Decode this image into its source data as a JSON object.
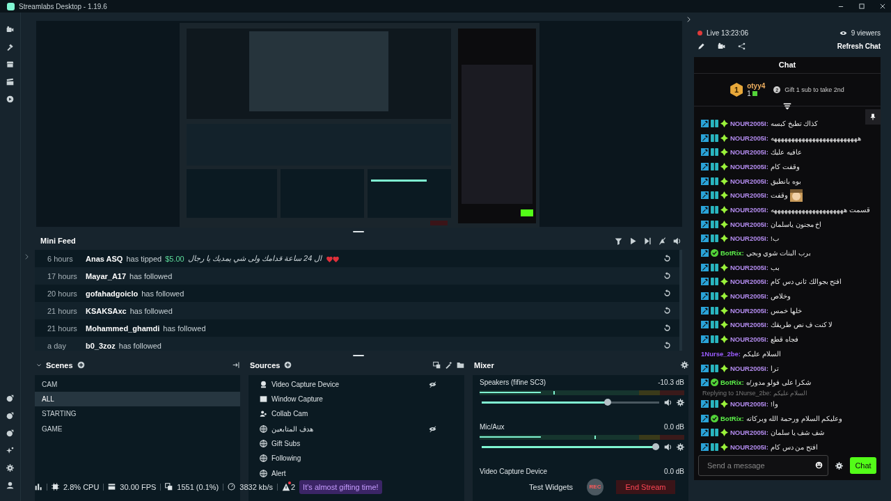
{
  "window": {
    "title": "Streamlabs Desktop - 1.19.6"
  },
  "nav": {
    "top": [
      {
        "kind": "camera"
      },
      {
        "kind": "themes"
      },
      {
        "kind": "store"
      },
      {
        "kind": "clapper"
      },
      {
        "kind": "play"
      }
    ],
    "bottom": [
      {
        "kind": "link1"
      },
      {
        "kind": "link2"
      },
      {
        "kind": "link3"
      },
      {
        "kind": "sparkle"
      },
      {
        "kind": "settings"
      },
      {
        "kind": "user"
      }
    ]
  },
  "mini_feed": {
    "title": "Mini Feed",
    "rows": [
      {
        "time": "6 hours",
        "user": "Anas ASQ",
        "action": "has tipped",
        "amount": "$5.00",
        "message": "ال 24 ساعة قدامك ولى شي يمديك يا رجال",
        "hearts": true
      },
      {
        "time": "17 hours",
        "user": "Mayar_A17",
        "action": "has followed"
      },
      {
        "time": "20 hours",
        "user": "gofahadgoiclo",
        "action": "has followed"
      },
      {
        "time": "21 hours",
        "user": "KSAKSAxc",
        "action": "has followed"
      },
      {
        "time": "21 hours",
        "user": "Mohammed_ghamdi",
        "action": "has followed"
      },
      {
        "time": "a day",
        "user": "b0_3zoz",
        "action": "has followed"
      }
    ]
  },
  "scenes": {
    "title": "Scenes",
    "items": [
      {
        "name": "CAM",
        "selected": false
      },
      {
        "name": "ALL",
        "selected": true
      },
      {
        "name": "STARTING",
        "selected": false
      },
      {
        "name": "GAME",
        "selected": false
      }
    ]
  },
  "sources": {
    "title": "Sources",
    "items": [
      {
        "name": "Video Capture Device",
        "kind": "webcam",
        "hidden": true
      },
      {
        "name": "Window Capture",
        "kind": "window",
        "hidden": false
      },
      {
        "name": "Collab Cam",
        "kind": "collab",
        "hidden": false
      },
      {
        "name": "هدف المتابعين",
        "kind": "browser",
        "hidden": true
      },
      {
        "name": "Gift Subs",
        "kind": "browser",
        "hidden": false
      },
      {
        "name": "Following",
        "kind": "browser",
        "hidden": false
      },
      {
        "name": "Alert",
        "kind": "browser",
        "hidden": false
      }
    ]
  },
  "mixer": {
    "title": "Mixer",
    "channels": [
      {
        "name": "Speakers (fifine SC3)",
        "reading": "-10.3 dB",
        "level": 0.72
      },
      {
        "name": "Mic/Aux",
        "reading": "0.0 dB",
        "level": 1.0
      },
      {
        "name": "Video Capture Device",
        "reading": "0.0 dB"
      }
    ]
  },
  "status_bar": {
    "cpu": "2.8% CPU",
    "fps": "30.00 FPS",
    "dropped": "1551 (0.1%)",
    "bitrate": "3832 kb/s",
    "alerts": "2",
    "notice": "It's almost gifting time!",
    "test_widgets": "Test Widgets",
    "rec": "REC",
    "end_stream": "End Stream"
  },
  "stream_info": {
    "live": "Live 13:23:06",
    "viewers": "9 viewers",
    "refresh": "Refresh Chat"
  },
  "chat": {
    "title": "Chat",
    "leader": {
      "rank": "1",
      "name": "otyy4",
      "count": "1",
      "next_rank": "2",
      "goal": "Gift 1 sub to take 2nd"
    },
    "messages": [
      {
        "badges": [
          {
            "kind": "mod"
          },
          {
            "kind": "bg"
          },
          {
            "kind": "gem"
          }
        ],
        "user": "NOUR2005I:",
        "color": "#b48cf0",
        "text": "كذاك تطبخ كبسه"
      },
      {
        "badges": [
          {
            "kind": "mod"
          },
          {
            "kind": "bg"
          },
          {
            "kind": "gem"
          }
        ],
        "user": "NOUR2005I:",
        "color": "#b48cf0",
        "text": "هههههههههههههههههههههههههه"
      },
      {
        "badges": [
          {
            "kind": "mod"
          },
          {
            "kind": "bg"
          },
          {
            "kind": "gem"
          }
        ],
        "user": "NOUR2005I:",
        "color": "#b48cf0",
        "text": "عافيه عليك"
      },
      {
        "badges": [
          {
            "kind": "mod"
          },
          {
            "kind": "bg"
          },
          {
            "kind": "gem"
          }
        ],
        "user": "NOUR2005I:",
        "color": "#b48cf0",
        "text": "وقفت كام"
      },
      {
        "badges": [
          {
            "kind": "mod"
          },
          {
            "kind": "bg"
          },
          {
            "kind": "gem"
          }
        ],
        "user": "NOUR2005I:",
        "color": "#b48cf0",
        "text": "بوه بانطيق"
      },
      {
        "badges": [
          {
            "kind": "mod"
          },
          {
            "kind": "bg"
          },
          {
            "kind": "gem"
          }
        ],
        "user": "NOUR2005I:",
        "color": "#b48cf0",
        "text": "وقفت",
        "emote": true
      },
      {
        "badges": [
          {
            "kind": "mod"
          },
          {
            "kind": "bg"
          },
          {
            "kind": "gem"
          }
        ],
        "user": "NOUR2005I:",
        "color": "#b48cf0",
        "text": "قسمت هههههههههههههههههههههه"
      },
      {
        "badges": [
          {
            "kind": "mod"
          },
          {
            "kind": "bg"
          },
          {
            "kind": "gem"
          }
        ],
        "user": "NOUR2005I:",
        "color": "#b48cf0",
        "text": "اخ مجنون ياسلمان"
      },
      {
        "badges": [
          {
            "kind": "mod"
          },
          {
            "kind": "bg"
          },
          {
            "kind": "gem"
          }
        ],
        "user": "NOUR2005I:",
        "color": "#b48cf0",
        "text": "ب!"
      },
      {
        "badges": [
          {
            "kind": "mod"
          },
          {
            "kind": "verified"
          }
        ],
        "user": "BotRix:",
        "color": "#5df34a",
        "text": "برب البنات شوي وبجي"
      },
      {
        "badges": [
          {
            "kind": "mod"
          },
          {
            "kind": "bg"
          },
          {
            "kind": "gem"
          }
        ],
        "user": "NOUR2005I:",
        "color": "#b48cf0",
        "text": "بب"
      },
      {
        "badges": [
          {
            "kind": "mod"
          },
          {
            "kind": "bg"
          },
          {
            "kind": "gem"
          }
        ],
        "user": "NOUR2005I:",
        "color": "#b48cf0",
        "text": "افتح بجوالك ثاني دس كام"
      },
      {
        "badges": [
          {
            "kind": "mod"
          },
          {
            "kind": "bg"
          },
          {
            "kind": "gem"
          }
        ],
        "user": "NOUR2005I:",
        "color": "#b48cf0",
        "text": "وخلاص"
      },
      {
        "badges": [
          {
            "kind": "mod"
          },
          {
            "kind": "bg"
          },
          {
            "kind": "gem"
          }
        ],
        "user": "NOUR2005I:",
        "color": "#b48cf0",
        "text": "خلها خمس"
      },
      {
        "badges": [
          {
            "kind": "mod"
          },
          {
            "kind": "bg"
          },
          {
            "kind": "gem"
          }
        ],
        "user": "NOUR2005I:",
        "color": "#b48cf0",
        "text": "لا كنت ف نص طريقك"
      },
      {
        "badges": [
          {
            "kind": "mod"
          },
          {
            "kind": "bg"
          },
          {
            "kind": "gem"
          }
        ],
        "user": "NOUR2005I:",
        "color": "#b48cf0",
        "text": "فجاه قطع"
      },
      {
        "user": "1Nurse_2be:",
        "color": "#9b5cff",
        "text": "السلام عليكم"
      },
      {
        "badges": [
          {
            "kind": "mod"
          },
          {
            "kind": "bg"
          },
          {
            "kind": "gem"
          }
        ],
        "user": "NOUR2005I:",
        "color": "#b48cf0",
        "text": "ترا"
      },
      {
        "badges": [
          {
            "kind": "mod"
          },
          {
            "kind": "verified"
          }
        ],
        "user": "BotRix:",
        "color": "#5df34a",
        "text": "شكرا على فولو مدور/ه"
      },
      {
        "badges": [
          {
            "kind": "mod"
          },
          {
            "kind": "bg"
          },
          {
            "kind": "gem"
          }
        ],
        "user": "NOUR2005I:",
        "color": "#b48cf0",
        "text": "وا!",
        "reply": "Replying to 1Nurse_2be: السلام عليكم"
      },
      {
        "badges": [
          {
            "kind": "mod"
          },
          {
            "kind": "verified"
          }
        ],
        "user": "BotRix:",
        "color": "#5df34a",
        "text": "وعليكم السلام ورحمة الله وبركاته"
      },
      {
        "badges": [
          {
            "kind": "mod"
          },
          {
            "kind": "bg"
          },
          {
            "kind": "gem"
          }
        ],
        "user": "NOUR2005I:",
        "color": "#b48cf0",
        "text": "شف شف يا سلمان"
      },
      {
        "badges": [
          {
            "kind": "mod"
          },
          {
            "kind": "bg"
          },
          {
            "kind": "gem"
          }
        ],
        "user": "NOUR2005I:",
        "color": "#b48cf0",
        "text": "افتح من دس كام"
      }
    ],
    "input": {
      "placeholder": "Send a message"
    },
    "send": "Chat"
  }
}
